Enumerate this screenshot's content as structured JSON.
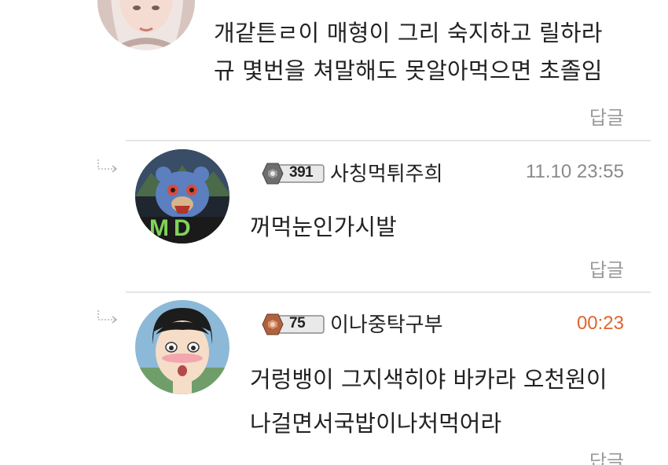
{
  "comments": [
    {
      "id": "top",
      "text_lines": [
        "개같튼ㄹ이 매형이 그리 숙지하고 릴하라",
        "규 몇번을 쳐말해도 못알아먹으면 초졸임"
      ],
      "reply_label": "답글"
    },
    {
      "id": "reply1",
      "level": "391",
      "nickname": "사칭먹튀주희",
      "timestamp": "11.10 23:55",
      "text_lines": [
        "꺼먹눈인가시발"
      ],
      "reply_label": "답글",
      "avatar_text": "MD"
    },
    {
      "id": "reply2",
      "level": "75",
      "nickname": "이나중탁구부",
      "timestamp": "00:23",
      "text_lines": [
        "거렁뱅이 그지색히야 바카라 오천원이",
        "나걸면서국밥이나처먹어라"
      ],
      "reply_label": "답글"
    }
  ],
  "colors": {
    "new_timestamp": "#e2632c",
    "muted": "#9a9a9a",
    "divider": "#e6e6e6"
  }
}
